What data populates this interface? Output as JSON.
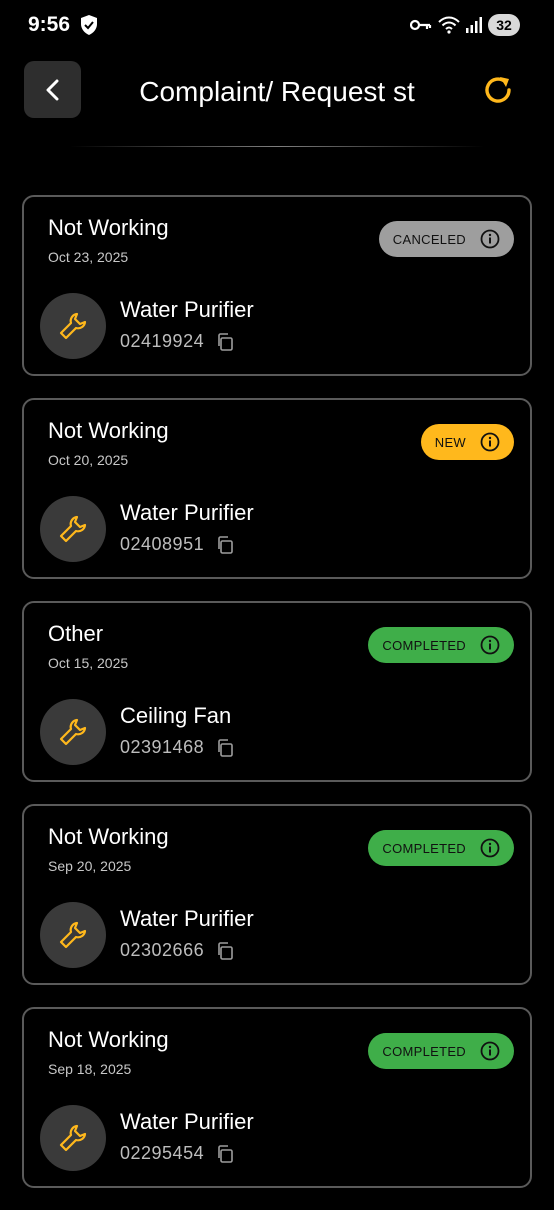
{
  "status_bar": {
    "time": "9:56",
    "battery": "32",
    "icons": [
      "shield-icon",
      "key-icon",
      "wifi-icon",
      "signal-icon"
    ]
  },
  "header": {
    "title": "Complaint/ Request st",
    "back_icon": "chevron-left-icon",
    "refresh_icon": "refresh-icon"
  },
  "colors": {
    "accent": "#ffb81c",
    "canceled": "#9e9e9e",
    "completed": "#3fae49",
    "card_border": "#5a5a5a"
  },
  "requests": [
    {
      "type": "Not Working",
      "date": "Oct 23, 2025",
      "status": "CANCELED",
      "product": "Water Purifier",
      "ticket": "02419924"
    },
    {
      "type": "Not Working",
      "date": "Oct 20, 2025",
      "status": "NEW",
      "product": "Water Purifier",
      "ticket": "02408951"
    },
    {
      "type": "Other",
      "date": "Oct 15, 2025",
      "status": "COMPLETED",
      "product": "Ceiling Fan",
      "ticket": "02391468"
    },
    {
      "type": "Not Working",
      "date": "Sep 20, 2025",
      "status": "COMPLETED",
      "product": "Water Purifier",
      "ticket": "02302666"
    },
    {
      "type": "Not Working",
      "date": "Sep 18, 2025",
      "status": "COMPLETED",
      "product": "Water Purifier",
      "ticket": "02295454"
    }
  ]
}
